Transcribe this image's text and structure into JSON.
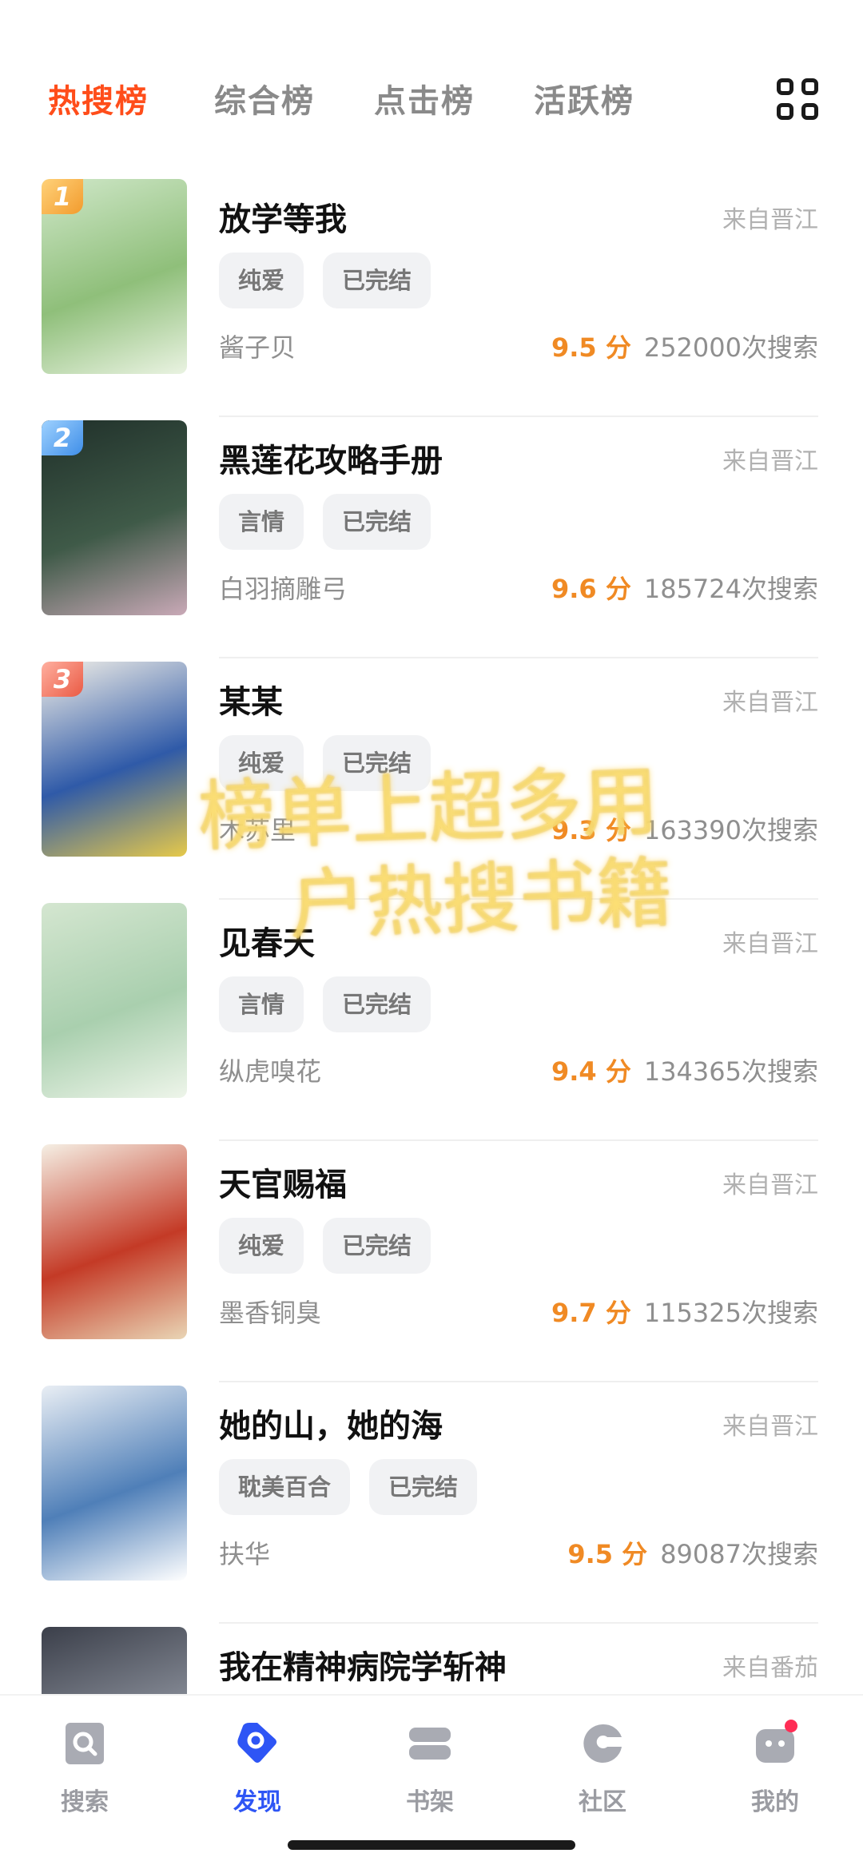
{
  "tabs": [
    {
      "label": "热搜榜",
      "active": true
    },
    {
      "label": "综合榜",
      "active": false
    },
    {
      "label": "点击榜",
      "active": false
    },
    {
      "label": "活跃榜",
      "active": false
    }
  ],
  "grid_icon": "grid-four-icon",
  "books": [
    {
      "rank": "1",
      "title": "放学等我",
      "source": "来自晋江",
      "tags": [
        "纯爱",
        "已完结"
      ],
      "author": "酱子贝",
      "score": "9.5 分",
      "searches": "252000次搜索",
      "cover_colors": [
        "#cfe7c8",
        "#8fbf7a",
        "#eaf3e2"
      ]
    },
    {
      "rank": "2",
      "title": "黑莲花攻略手册",
      "source": "来自晋江",
      "tags": [
        "言情",
        "已完结"
      ],
      "author": "白羽摘雕弓",
      "score": "9.6 分",
      "searches": "185724次搜索",
      "cover_colors": [
        "#20302a",
        "#3f5a48",
        "#c9a9b7"
      ]
    },
    {
      "rank": "3",
      "title": "某某",
      "source": "来自晋江",
      "tags": [
        "纯爱",
        "已完结"
      ],
      "author": "木苏里",
      "score": "9.3 分",
      "searches": "163390次搜索",
      "cover_colors": [
        "#f3f0e8",
        "#2f5aa8",
        "#e6c94a"
      ]
    },
    {
      "rank": "",
      "title": "见春天",
      "source": "来自晋江",
      "tags": [
        "言情",
        "已完结"
      ],
      "author": "纵虎嗅花",
      "score": "9.4 分",
      "searches": "134365次搜索",
      "cover_colors": [
        "#d4e6d0",
        "#a9cfae",
        "#eef5ea"
      ]
    },
    {
      "rank": "",
      "title": "天官赐福",
      "source": "来自晋江",
      "tags": [
        "纯爱",
        "已完结"
      ],
      "author": "墨香铜臭",
      "score": "9.7 分",
      "searches": "115325次搜索",
      "cover_colors": [
        "#f5efe4",
        "#c43a26",
        "#e9d5b5"
      ]
    },
    {
      "rank": "",
      "title": "她的山，她的海",
      "source": "来自晋江",
      "tags": [
        "耽美百合",
        "已完结"
      ],
      "author": "扶华",
      "score": "9.5 分",
      "searches": "89087次搜索",
      "cover_colors": [
        "#e9eef4",
        "#4f7fb8",
        "#ffffff"
      ]
    },
    {
      "rank": "",
      "title": "我在精神病院学斩神",
      "source": "来自番茄",
      "tags": [],
      "author": "",
      "score": "",
      "searches": "",
      "cover_colors": [
        "#3b3f4a",
        "#8a8f9a",
        "#c8ccd4"
      ]
    }
  ],
  "watermark": {
    "line1": "榜单上超多用",
    "line2": "户热搜书籍"
  },
  "nav": [
    {
      "label": "搜索",
      "icon": "search-icon",
      "active": false
    },
    {
      "label": "发现",
      "icon": "discover-icon",
      "active": true
    },
    {
      "label": "书架",
      "icon": "bookshelf-icon",
      "active": false
    },
    {
      "label": "社区",
      "icon": "community-icon",
      "active": false
    },
    {
      "label": "我的",
      "icon": "profile-icon",
      "active": false
    }
  ],
  "colors": {
    "accent": "#ff4d1a",
    "score": "#f08a24",
    "nav_active": "#2e55f5",
    "nav_inactive": "#a9abb3"
  }
}
